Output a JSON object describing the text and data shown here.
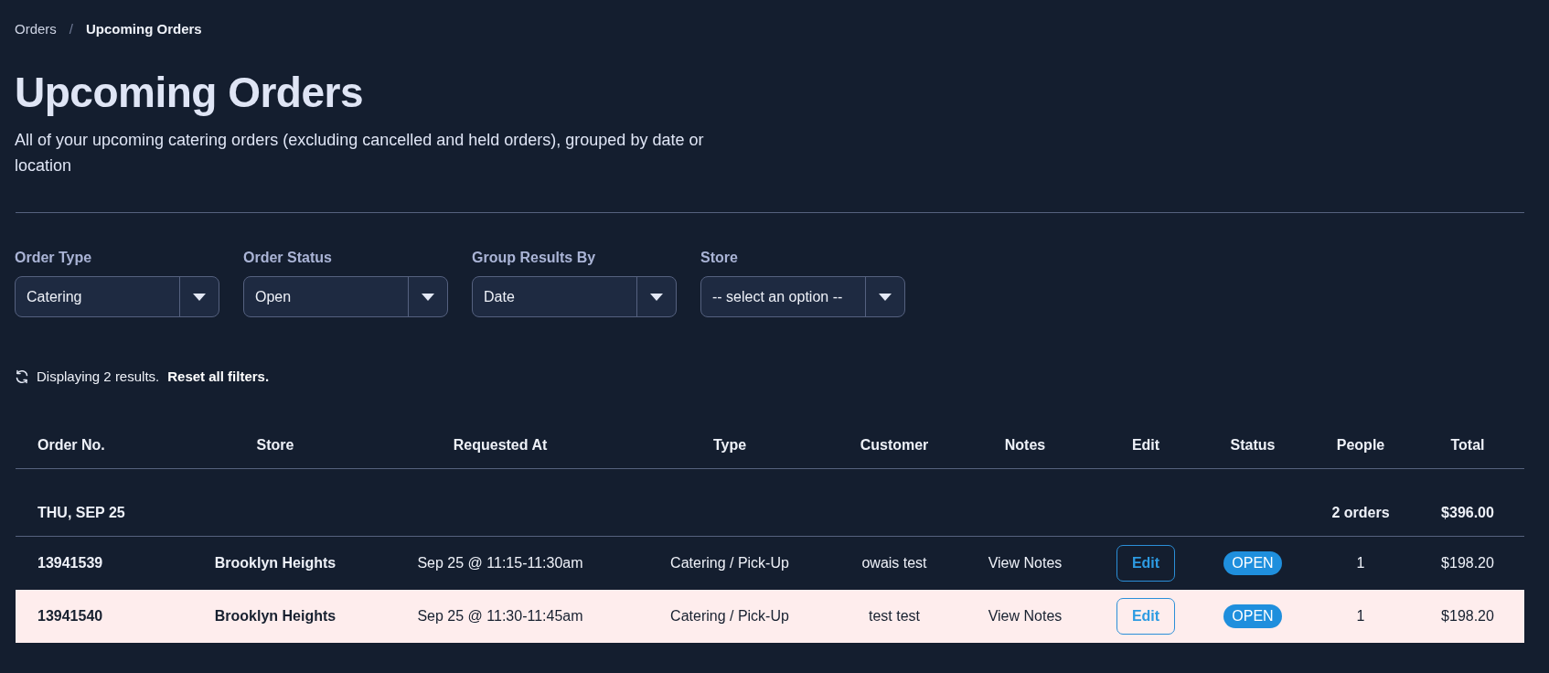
{
  "breadcrumb": {
    "separator": "/",
    "items": [
      {
        "label": "Orders",
        "current": false
      },
      {
        "label": "Upcoming Orders",
        "current": true
      }
    ]
  },
  "page": {
    "title": "Upcoming Orders",
    "description": "All of your upcoming catering orders (excluding cancelled and held orders), grouped by date or location"
  },
  "filters": [
    {
      "label": "Order Type",
      "value": "Catering"
    },
    {
      "label": "Order Status",
      "value": "Open"
    },
    {
      "label": "Group Results By",
      "value": "Date"
    },
    {
      "label": "Store",
      "value": "-- select an option --"
    }
  ],
  "results": {
    "text": "Displaying 2 results.",
    "reset_link": "Reset all filters."
  },
  "table": {
    "columns": [
      "Order No.",
      "Store",
      "Requested At",
      "Type",
      "Customer",
      "Notes",
      "Edit",
      "Status",
      "People",
      "Total"
    ],
    "groups": [
      {
        "label": "THU, SEP 25",
        "order_count": "2 orders",
        "total": "$396.00",
        "rows": [
          {
            "order_no": "13941539",
            "store": "Brooklyn Heights",
            "requested_at": "Sep 25 @ 11:15-11:30am",
            "type": "Catering / Pick-Up",
            "customer": "owais test",
            "notes": "View Notes",
            "edit": "Edit",
            "status": "OPEN",
            "people": "1",
            "total": "$198.20",
            "highlighted": false
          },
          {
            "order_no": "13941540",
            "store": "Brooklyn Heights",
            "requested_at": "Sep 25 @ 11:30-11:45am",
            "type": "Catering / Pick-Up",
            "customer": "test test",
            "notes": "View Notes",
            "edit": "Edit",
            "status": "OPEN",
            "people": "1",
            "total": "$198.20",
            "highlighted": true
          }
        ]
      }
    ]
  }
}
